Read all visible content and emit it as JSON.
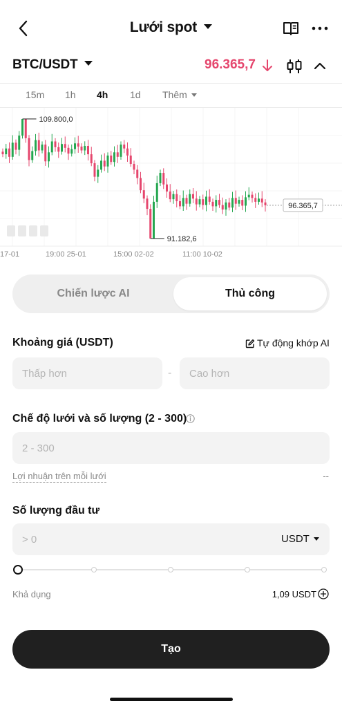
{
  "header": {
    "title": "Lưới spot"
  },
  "market": {
    "pair": "BTC/USDT",
    "price": "96.365,7",
    "price_direction": "down",
    "price_color": "#e5466d"
  },
  "timeframes": [
    {
      "label": "15m",
      "active": false
    },
    {
      "label": "1h",
      "active": false
    },
    {
      "label": "4h",
      "active": true
    },
    {
      "label": "1d",
      "active": false
    },
    {
      "label": "Thêm",
      "active": false
    }
  ],
  "chart_data": {
    "type": "candlestick",
    "high_label": "109.800,0",
    "low_label": "91.182,6",
    "current_label": "96.365,7",
    "x_ticks": [
      "17-01",
      "19:00 25-01",
      "15:00 02-02",
      "11:00 10-02"
    ],
    "watermark": "OKX",
    "up_color": "#25a750",
    "down_color": "#e5466d",
    "close_series": [
      104300,
      105200,
      103900,
      106100,
      105000,
      107200,
      109800,
      106800,
      103400,
      104800,
      106500,
      104900,
      105800,
      103200,
      104600,
      106300,
      105400,
      104700,
      105900,
      105300,
      104400,
      105100,
      106000,
      105500,
      104900,
      105600,
      104300,
      102900,
      100800,
      101900,
      103300,
      102400,
      104100,
      103100,
      104600,
      103900,
      105800,
      105200,
      104100,
      102800,
      101900,
      100600,
      98700,
      97400,
      95800,
      91182.6,
      96900,
      99800,
      101400,
      99600,
      98500,
      97300,
      98100,
      97000,
      96200,
      97500,
      96600,
      98100,
      97400,
      96500,
      97300,
      96400,
      97700,
      96900,
      96200,
      97200,
      96400,
      95700,
      96800,
      96000,
      97500,
      96600,
      97200,
      96300,
      97600,
      98000,
      97500,
      96900,
      97400,
      96800,
      96365.7
    ]
  },
  "strategy_tabs": {
    "ai": "Chiến lược AI",
    "manual": "Thủ công",
    "active": "manual"
  },
  "price_range": {
    "label": "Khoảng giá (USDT)",
    "auto_match": "Tự động khớp AI",
    "lower_placeholder": "Thấp hơn",
    "upper_placeholder": "Cao hơn",
    "separator": "-"
  },
  "grid": {
    "label": "Chế độ lưới và số lượng (2 - 300)",
    "placeholder": "2 - 300",
    "profit_label": "Lợi nhuận trên mỗi lưới",
    "profit_value": "--"
  },
  "investment": {
    "label": "Số lượng đầu tư",
    "placeholder": "> 0",
    "unit": "USDT",
    "slider_value": 0,
    "available_label": "Khả dụng",
    "available_value": "1,09 USDT"
  },
  "create_button": "Tạo"
}
